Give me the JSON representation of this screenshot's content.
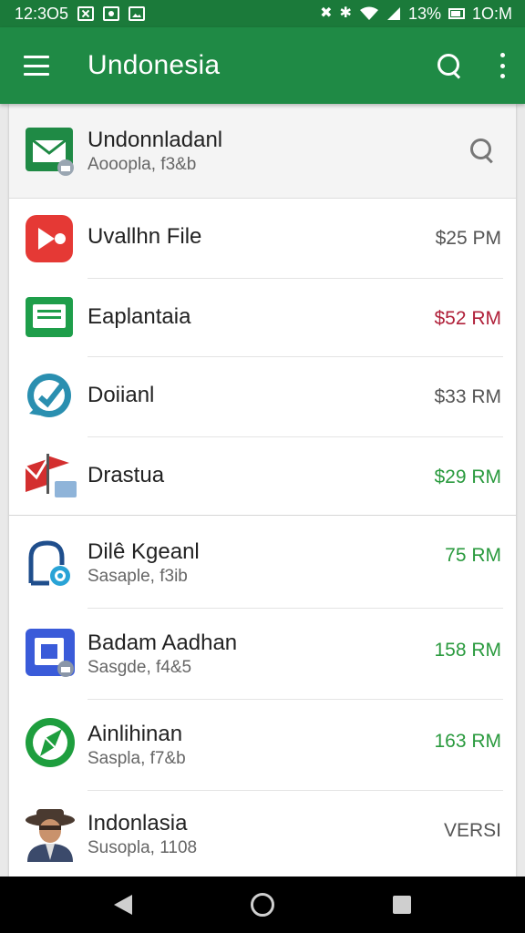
{
  "status_bar": {
    "time": "12:3O5",
    "battery": "13%",
    "clock_right": "1O:M"
  },
  "app_bar": {
    "title": "Undonesia"
  },
  "header_row": {
    "title": "Undonnladanl",
    "subtitle": "Aooopla, f3&b"
  },
  "items": [
    {
      "title": "Uvallhn File",
      "subtitle": "",
      "amount": "$25 PM",
      "amount_color": "#555555",
      "icon": "video-play-icon"
    },
    {
      "title": "Eaplantaia",
      "subtitle": "",
      "amount": "$52 RM",
      "amount_color": "#b0213a",
      "icon": "chat-message-icon"
    },
    {
      "title": "Doiianl",
      "subtitle": "",
      "amount": "$33 RM",
      "amount_color": "#555555",
      "icon": "checkmark-chat-icon"
    },
    {
      "title": "Drastua",
      "subtitle": "",
      "amount": "$29 RM",
      "amount_color": "#2a9a3e",
      "icon": "flag-envelope-icon"
    },
    {
      "title": "Dilê Kgeanl",
      "subtitle": "Sasaple, f3ib",
      "amount": "75 RM",
      "amount_color": "#2a9a3e",
      "icon": "lock-badge-icon"
    },
    {
      "title": "Badam Aadhan",
      "subtitle": "Sasgde, f4&5",
      "amount": "158 RM",
      "amount_color": "#2a9a3e",
      "icon": "photo-frame-icon"
    },
    {
      "title": "Ainlihinan",
      "subtitle": "Saspla, f7&b",
      "amount": "163 RM",
      "amount_color": "#2a9a3e",
      "icon": "compass-icon"
    },
    {
      "title": "Indonlasia",
      "subtitle": "Susopla, 1108",
      "amount": "VERSI",
      "amount_color": "#555555",
      "icon": "avatar-hat-icon"
    }
  ]
}
